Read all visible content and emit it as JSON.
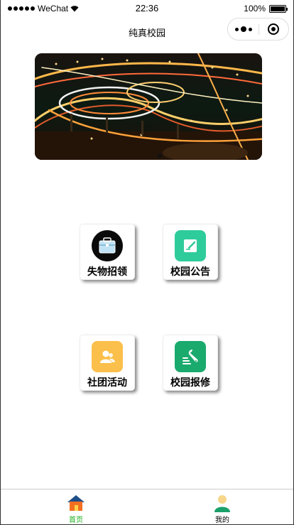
{
  "status_bar": {
    "carrier": "WeChat",
    "time": "22:36",
    "battery_percent": "100%"
  },
  "navbar": {
    "title": "纯真校园",
    "more_icon": "more-dots-icon",
    "close_icon": "target-circle-icon"
  },
  "banner": {
    "image": "night-city-highway-interchange",
    "page_count": 1,
    "active_index": 0
  },
  "grid": {
    "items": [
      {
        "label": "失物招领",
        "icon": "briefcase-icon",
        "color": "#0a0a0a"
      },
      {
        "label": "校园公告",
        "icon": "notepad-icon",
        "color": "#2ecc9b"
      },
      {
        "label": "社团活动",
        "icon": "people-icon",
        "color": "#fbbf4b"
      },
      {
        "label": "校园报修",
        "icon": "wrench-icon",
        "color": "#1aaa6e"
      }
    ]
  },
  "tabbar": {
    "tabs": [
      {
        "label": "首页",
        "icon": "home-icon",
        "active": true,
        "color": "#1aad19"
      },
      {
        "label": "我的",
        "icon": "user-icon",
        "active": false,
        "color": "#000000"
      }
    ]
  }
}
